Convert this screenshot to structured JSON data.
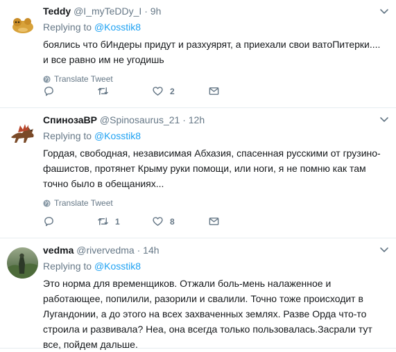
{
  "tweets": [
    {
      "name": "Teddy",
      "handle": "@I_myTeDDy_I",
      "time": "9h",
      "replying_label": "Replying to",
      "replying_to": "@Kosstik8",
      "text": "боялись что бИндеры придут и разхуярят, а приехали свои ватоПитерки....\nи все равно им не угодишь",
      "translate_label": "Translate Tweet",
      "reply_count": "",
      "retweet_count": "",
      "like_count": "2"
    },
    {
      "name": "СпинозаВР",
      "handle": "@Spinosaurus_21",
      "time": "12h",
      "replying_label": "Replying to",
      "replying_to": "@Kosstik8",
      "text": "Гордая, свободная, независимая Абхазия, спасенная русскими от грузино-\nфашистов, протянет Крыму руки помощи, или ноги, я не помню как там\nточно было в обещаниях...",
      "translate_label": "Translate Tweet",
      "reply_count": "",
      "retweet_count": "1",
      "like_count": "8"
    },
    {
      "name": "vedma",
      "handle": "@rivervedma",
      "time": "14h",
      "replying_label": "Replying to",
      "replying_to": "@Kosstik8",
      "text": "Это норма для временщиков. Отжали боль-мень налаженное и\nработающее, попилили, разорили и свалили. Точно тоже происходит в\nЛугандонии, а до этого на всех захваченных землях. Разве Орда что-то\nстроила и развивала? Неа, она всегда только пользовалась.Засрали тут\nвсе, пойдем дальше."
    }
  ],
  "icons": {
    "caret": "chevron-down-icon",
    "translate": "globe-icon",
    "reply": "reply-icon",
    "retweet": "retweet-icon",
    "like": "heart-icon",
    "dm": "envelope-icon"
  },
  "colors": {
    "link": "#1da1f2",
    "secondary_text": "#657786",
    "divider": "#e6ecf0"
  }
}
